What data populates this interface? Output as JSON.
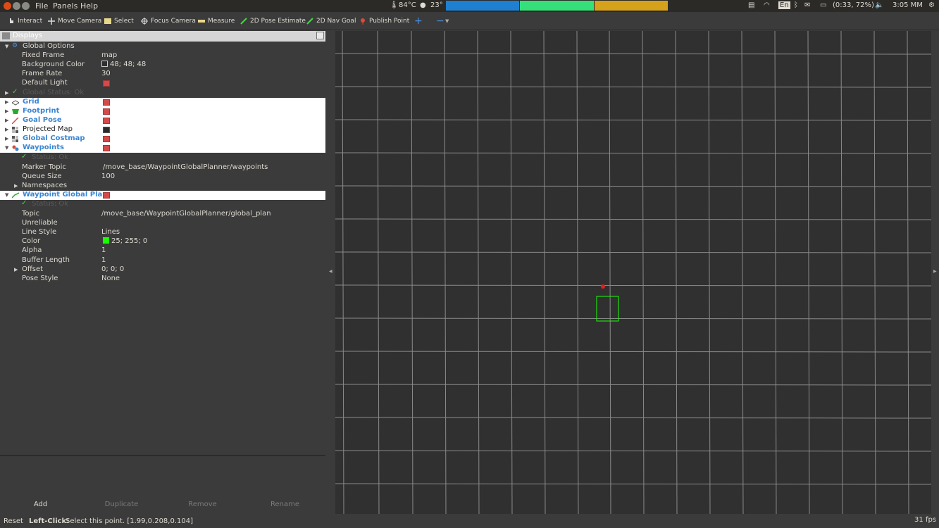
{
  "menubar": {
    "menus": [
      "File",
      "Panels",
      "Help"
    ],
    "cpu_temp": "84°C",
    "weather": "23°",
    "battery": "(0:33, 72%)",
    "keyboard_layout": "En",
    "clock": "3:05 MM",
    "graph_colors": [
      "#1f7fd0",
      "#35e07a",
      "#d7a21b"
    ]
  },
  "toolbar": {
    "tools": [
      {
        "label": "Interact",
        "icon": "cursor-hand-icon"
      },
      {
        "label": "Move Camera",
        "icon": "move-arrows-icon"
      },
      {
        "label": "Select",
        "icon": "select-box-icon"
      },
      {
        "label": "Focus Camera",
        "icon": "crosshair-icon"
      },
      {
        "label": "Measure",
        "icon": "ruler-icon"
      },
      {
        "label": "2D Pose Estimate",
        "icon": "green-arrow-icon"
      },
      {
        "label": "2D Nav Goal",
        "icon": "green-arrow-icon"
      },
      {
        "label": "Publish Point",
        "icon": "pin-icon"
      }
    ],
    "add_symbol": "+",
    "remove_symbol": "−"
  },
  "displays": {
    "title": "Displays",
    "rows": [
      {
        "name": "Global Options",
        "value": ""
      },
      {
        "name": "Fixed Frame",
        "value": "map"
      },
      {
        "name": "Background Color",
        "value": "48; 48; 48"
      },
      {
        "name": "Frame Rate",
        "value": "30"
      },
      {
        "name": "Default Light",
        "value": ""
      },
      {
        "name": "Global Status: Ok",
        "value": ""
      },
      {
        "name": "Grid",
        "value": ""
      },
      {
        "name": "Footprint",
        "value": ""
      },
      {
        "name": "Goal Pose",
        "value": ""
      },
      {
        "name": "Projected Map",
        "value": ""
      },
      {
        "name": "Global Costmap",
        "value": ""
      },
      {
        "name": "Waypoints",
        "value": ""
      },
      {
        "name": "Status: Ok",
        "value": ""
      },
      {
        "name": "Marker Topic",
        "value": "/move_base/WaypointGlobalPlanner/waypoints"
      },
      {
        "name": "Queue Size",
        "value": "100"
      },
      {
        "name": "Namespaces",
        "value": ""
      },
      {
        "name": "Waypoint Global Plan",
        "value": ""
      },
      {
        "name": "Status: Ok",
        "value": ""
      },
      {
        "name": "Topic",
        "value": "/move_base/WaypointGlobalPlanner/global_plan"
      },
      {
        "name": "Unreliable",
        "value": ""
      },
      {
        "name": "Line Style",
        "value": "Lines"
      },
      {
        "name": "Color",
        "value": "25; 255; 0"
      },
      {
        "name": "Alpha",
        "value": "1"
      },
      {
        "name": "Buffer Length",
        "value": "1"
      },
      {
        "name": "Offset",
        "value": "0; 0; 0"
      },
      {
        "name": "Pose Style",
        "value": "None"
      }
    ],
    "background_color_hex": "#303030",
    "plan_color_hex": "#19ff00"
  },
  "panel_buttons": {
    "add": "Add",
    "duplicate": "Duplicate",
    "remove": "Remove",
    "rename": "Rename"
  },
  "status": {
    "reset": "Reset",
    "hint_key": "Left-Click:",
    "hint_text": "Select this point. [1.99,0.208,0.104]",
    "fps": "31 fps"
  }
}
